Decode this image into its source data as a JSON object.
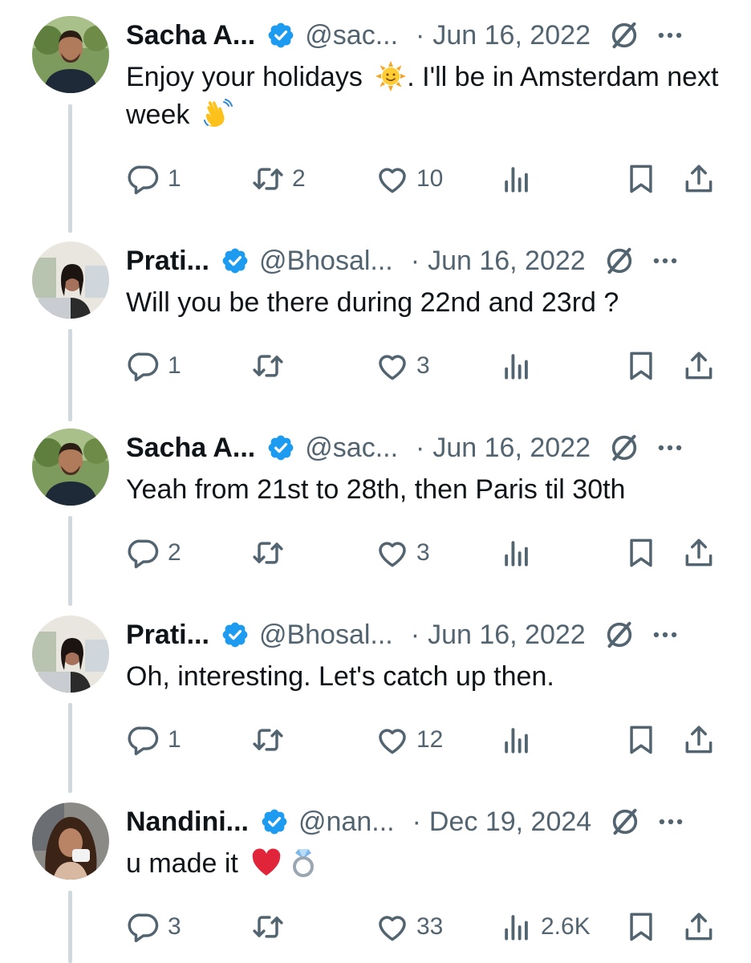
{
  "tweets": [
    {
      "author_name": "Sacha A...",
      "handle": "@sac...",
      "separator": "·",
      "date": "Jun 16, 2022",
      "text_segments": [
        "Enjoy your holidays ",
        ". I'll be in Amsterdam next week "
      ],
      "emojis": [
        "sun-with-face",
        "waving-hand"
      ],
      "replies": "1",
      "reposts": "2",
      "likes": "10",
      "views": ""
    },
    {
      "author_name": "Prati...",
      "handle": "@Bhosal...",
      "separator": "·",
      "date": "Jun 16, 2022",
      "text": "Will you be there during 22nd and 23rd ?",
      "replies": "1",
      "reposts": "",
      "likes": "3",
      "views": ""
    },
    {
      "author_name": "Sacha A...",
      "handle": "@sac...",
      "separator": "·",
      "date": "Jun 16, 2022",
      "text": "Yeah from 21st to 28th, then Paris til 30th",
      "replies": "2",
      "reposts": "",
      "likes": "3",
      "views": ""
    },
    {
      "author_name": "Prati...",
      "handle": "@Bhosal...",
      "separator": "·",
      "date": "Jun 16, 2022",
      "text": "Oh, interesting. Let's catch up then.",
      "replies": "1",
      "reposts": "",
      "likes": "12",
      "views": ""
    },
    {
      "author_name": "Nandini...",
      "handle": "@nan...",
      "separator": "·",
      "date": "Dec 19, 2024",
      "text": "u made it ",
      "emojis": [
        "red-heart",
        "ring"
      ],
      "replies": "3",
      "reposts": "",
      "likes": "33",
      "views": "2.6K"
    }
  ],
  "colors": {
    "text": "#0f1419",
    "secondary": "#536471",
    "verified": "#1d9bf0",
    "thread_line": "#cfd9de"
  },
  "icons": [
    "verified-badge-icon",
    "grok-icon",
    "more-icon",
    "reply-icon",
    "repost-icon",
    "like-icon",
    "views-icon",
    "bookmark-icon",
    "share-icon"
  ]
}
